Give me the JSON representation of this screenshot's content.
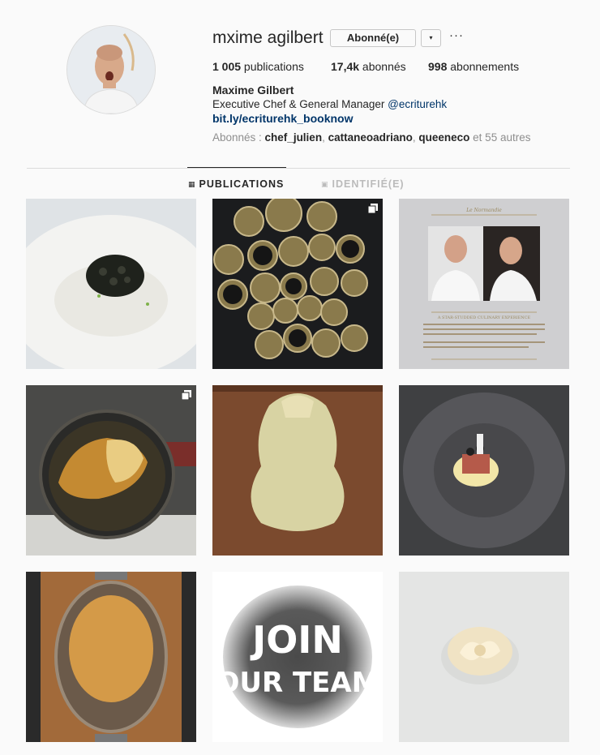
{
  "profile": {
    "username": "mxime agilbert",
    "follow_label": "Abonné(e)",
    "dropdown_glyph": "▾",
    "more_glyph": "···",
    "stats": [
      {
        "value": "1 005",
        "label": " publications"
      },
      {
        "value": "17,4k",
        "label": " abonnés"
      },
      {
        "value": "998",
        "label": " abonnements"
      }
    ],
    "full_name": "Maxime Gilbert",
    "bio_text": "Executive Chef & General Manager ",
    "bio_mention": "@ecriturehk",
    "link": "bit.ly/ecriturehk_booknow",
    "followed_by_prefix": "Abonnés : ",
    "followed_by_names": [
      "chef_julien",
      "cattaneoadriano",
      "queeneco"
    ],
    "followed_by_sep": ", ",
    "followed_by_suffix": " et 55 autres"
  },
  "tabs": [
    {
      "icon": "grid-icon",
      "label": "PUBLICATIONS",
      "active": true
    },
    {
      "icon": "tag-icon",
      "label": "IDENTIFIÉ(E)",
      "active": false
    }
  ],
  "join_team": {
    "line1": "JOIN",
    "line2": "OUR TEAM"
  },
  "poster": {
    "header": "Le Normandie",
    "subtitle": "A STAR-STUDDED CULINARY EXPERIENCE"
  },
  "colors": {
    "link": "#003569",
    "muted": "#8e8e8e",
    "border": "#dbdbdb"
  }
}
